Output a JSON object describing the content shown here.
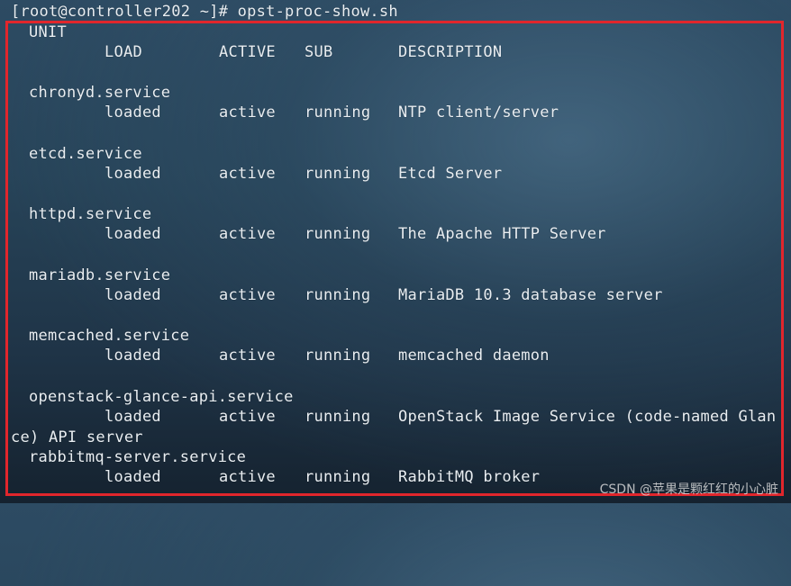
{
  "terminal": {
    "prompt": "[root@controller202 ~]# opst-proc-show.sh",
    "header": {
      "unit": "UNIT",
      "load": "LOAD",
      "active": "ACTIVE",
      "sub": "SUB",
      "description": "DESCRIPTION"
    },
    "services": [
      {
        "unit": "chronyd.service",
        "load": "loaded",
        "active": "active",
        "sub": "running",
        "description": "NTP client/server"
      },
      {
        "unit": "etcd.service",
        "load": "loaded",
        "active": "active",
        "sub": "running",
        "description": "Etcd Server"
      },
      {
        "unit": "httpd.service",
        "load": "loaded",
        "active": "active",
        "sub": "running",
        "description": "The Apache HTTP Server"
      },
      {
        "unit": "mariadb.service",
        "load": "loaded",
        "active": "active",
        "sub": "running",
        "description": "MariaDB 10.3 database server"
      },
      {
        "unit": "memcached.service",
        "load": "loaded",
        "active": "active",
        "sub": "running",
        "description": "memcached daemon"
      },
      {
        "unit": "openstack-glance-api.service",
        "load": "loaded",
        "active": "active",
        "sub": "running",
        "description": "OpenStack Image Service (code-named Glan"
      },
      {
        "unit": "rabbitmq-server.service",
        "load": "loaded",
        "active": "active",
        "sub": "running",
        "description": "RabbitMQ broker"
      }
    ],
    "wrapped_line": "ce) API server"
  },
  "watermark": "CSDN @苹果是颗红红的小心脏",
  "colors": {
    "highlight_border": "#e1262c",
    "text": "#e9eef2"
  }
}
